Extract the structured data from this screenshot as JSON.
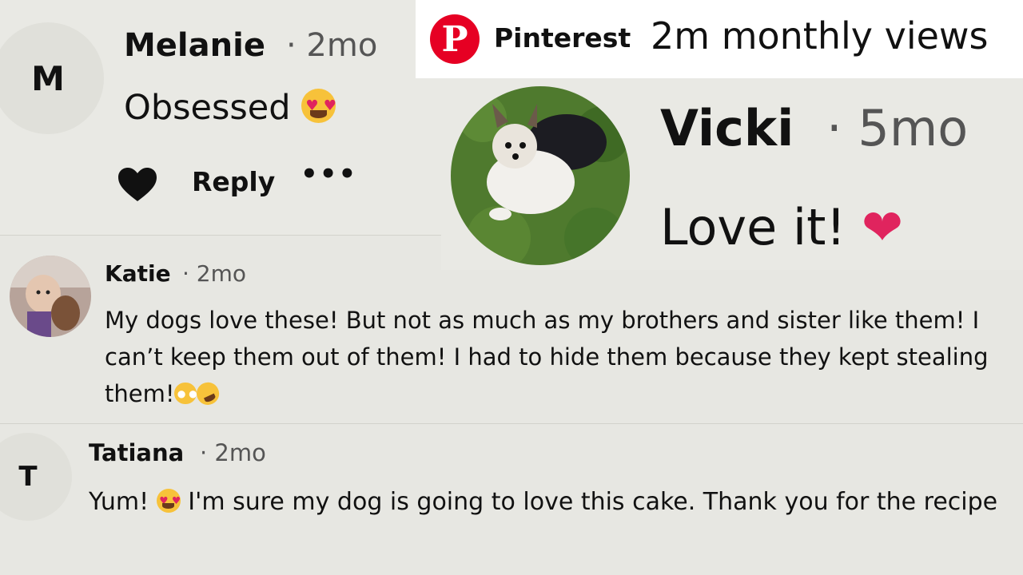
{
  "pinterest": {
    "logo_letter": "P",
    "brand": "Pinterest",
    "views": "2m monthly views",
    "brand_color": "#e60023"
  },
  "comments": [
    {
      "name": "Melanie",
      "time": "· 2mo",
      "avatar_letter": "M",
      "text": "Obsessed",
      "emoji": "heart-eyes",
      "actions": {
        "reply": "Reply",
        "more": "•••"
      }
    },
    {
      "name": "Vicki",
      "time": "· 5mo",
      "avatar": "dog-photo",
      "text": "Love it!",
      "emoji": "❤"
    },
    {
      "name": "Katie",
      "time": "· 2mo",
      "avatar": "child-photo",
      "text": "My dogs love these! But not as much as my brothers and sister like them! I can’t keep them out of them! I had to hide them because they kept stealing them!",
      "emoji": "eye-roll rofl"
    },
    {
      "name": "Tatiana",
      "time": "· 2mo",
      "avatar_letter": "T",
      "text_before": "Yum!",
      "text_after": "I'm sure my dog is going to love this cake. Thank you for the recipe",
      "emoji": "heart-eyes"
    }
  ]
}
